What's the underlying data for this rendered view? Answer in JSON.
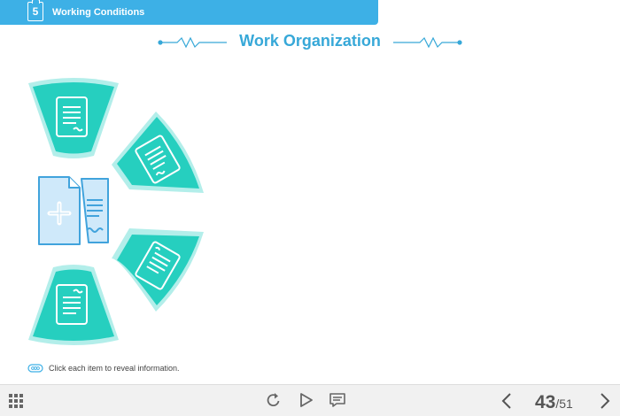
{
  "header": {
    "chapter_number": "5",
    "chapter_title": "Working Conditions"
  },
  "page": {
    "title": "Work Organization"
  },
  "tabs": [
    {
      "name": "document-tab-1",
      "icon": "document-icon"
    },
    {
      "name": "document-tab-2",
      "icon": "document-icon"
    },
    {
      "name": "document-tab-3",
      "icon": "document-icon"
    },
    {
      "name": "document-tab-4",
      "icon": "document-icon"
    }
  ],
  "center_icon": "add-document-icon",
  "hint": {
    "icon": "link-icon",
    "text": "Click each item to reveal information."
  },
  "player": {
    "menu_icon": "grid-menu-icon",
    "replay_icon": "replay-icon",
    "play_icon": "play-icon",
    "notes_icon": "notes-icon",
    "prev_icon": "chevron-left-icon",
    "next_icon": "chevron-right-icon",
    "current_page": "43",
    "total_pages": "/51"
  },
  "colors": {
    "accent": "#3db0e6",
    "title": "#37a8d8",
    "teal": "#26cfbf",
    "teal_halo": "#b3eeea",
    "doc_fill": "#cfe9fa",
    "doc_stroke": "#41a3dc",
    "player_bg": "#f1f1f1"
  }
}
